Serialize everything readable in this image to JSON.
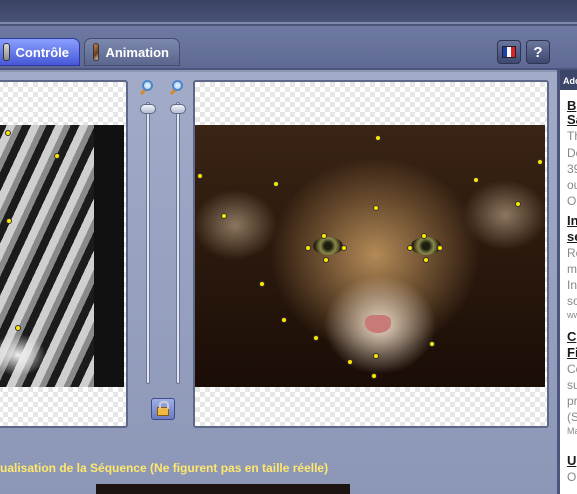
{
  "tabs": [
    {
      "label": "Contrôle",
      "active": true
    },
    {
      "label": "Animation",
      "active": false
    }
  ],
  "header_buttons": {
    "language_flag": "flag-fr-icon",
    "help_label": "?"
  },
  "sequence_caption": "ualisation de la Séquence (Ne figurent pas en taille réelle)",
  "sidebar": {
    "header": "Adc",
    "lines": [
      {
        "text": "B",
        "style": "b"
      },
      {
        "text": "Sa",
        "style": "b"
      },
      {
        "text": "Th",
        "style": "g"
      },
      {
        "text": "De",
        "style": "g"
      },
      {
        "text": "39",
        "style": "g"
      },
      {
        "text": "ou",
        "style": "g"
      },
      {
        "text": "OL",
        "style": "g"
      },
      {
        "text": "In",
        "style": "b"
      },
      {
        "text": "se",
        "style": "b"
      },
      {
        "text": "Re",
        "style": "g"
      },
      {
        "text": "m",
        "style": "g"
      },
      {
        "text": "In",
        "style": "g"
      },
      {
        "text": "so",
        "style": "g"
      },
      {
        "text": "ww",
        "style": "s"
      },
      {
        "text": "C",
        "style": "b"
      },
      {
        "text": "Fi",
        "style": "b"
      },
      {
        "text": "Co",
        "style": "g"
      },
      {
        "text": "su",
        "style": "g"
      },
      {
        "text": "pr",
        "style": "g"
      },
      {
        "text": "(S",
        "style": "g"
      },
      {
        "text": "Ma",
        "style": "s"
      },
      {
        "text": "U",
        "style": "b"
      },
      {
        "text": "O",
        "style": "g"
      }
    ]
  },
  "colors": {
    "active_tab": "#4657d6",
    "caption": "#ffe86b",
    "marker": "#ffe600"
  }
}
